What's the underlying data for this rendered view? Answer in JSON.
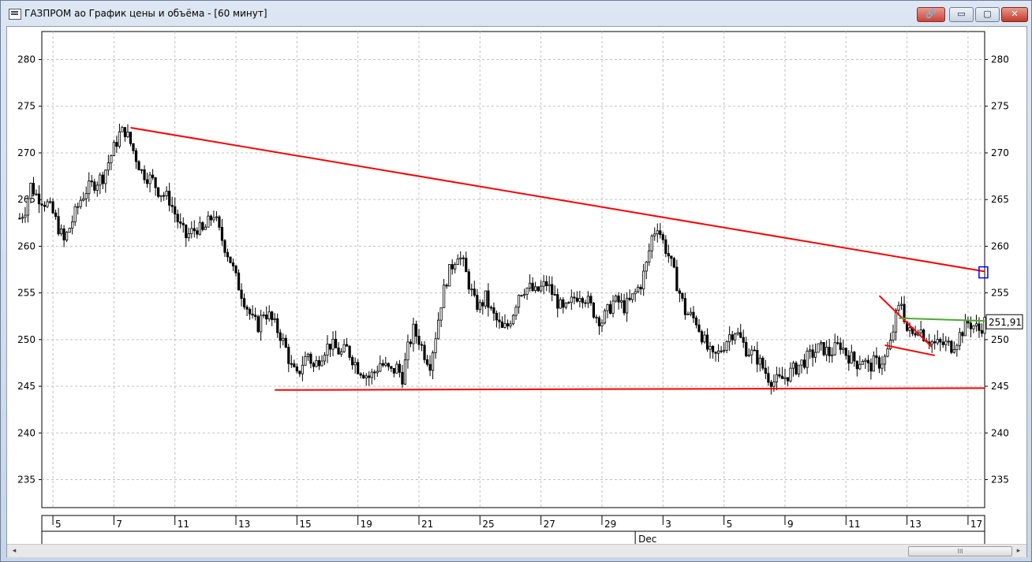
{
  "window": {
    "title": "ГАЗПРОМ ао График цены и объёма - [60 минут]",
    "buttons": {
      "link": "🔗",
      "minimize": "▭",
      "maximize": "▢",
      "close": "✕"
    }
  },
  "scrollbar": {
    "left_arrow": "◂",
    "right_arrow": "▸",
    "grip": "III"
  },
  "chart_data": {
    "type": "candlestick",
    "ylim": [
      232,
      283
    ],
    "yticks": [
      235,
      240,
      245,
      250,
      255,
      260,
      265,
      270,
      275,
      280
    ],
    "ytick_labels": [
      "235",
      "240",
      "245",
      "250",
      "255",
      "260",
      "265",
      "270",
      "275",
      "280"
    ],
    "grid": true,
    "xlim": [
      4,
      174
    ],
    "x_ticks": [
      {
        "x": 6,
        "label": "5"
      },
      {
        "x": 17,
        "label": "7"
      },
      {
        "x": 28,
        "label": "11"
      },
      {
        "x": 39,
        "label": "13"
      },
      {
        "x": 50,
        "label": "15"
      },
      {
        "x": 61,
        "label": "19"
      },
      {
        "x": 72,
        "label": "21"
      },
      {
        "x": 83,
        "label": "25"
      },
      {
        "x": 94,
        "label": "27"
      },
      {
        "x": 105,
        "label": "29"
      },
      {
        "x": 116,
        "label": "3"
      },
      {
        "x": 127,
        "label": "5"
      },
      {
        "x": 138,
        "label": "9"
      },
      {
        "x": 149,
        "label": "11"
      },
      {
        "x": 160,
        "label": "13"
      },
      {
        "x": 171,
        "label": "17"
      }
    ],
    "month_label": "Dec",
    "month_x": 111,
    "last_price": "251,91",
    "last_price_value": 251.91,
    "colors": {
      "candle": "#000000",
      "trendline": "#ff0000",
      "trendline_green": "#4ea832",
      "grid": "#c0c0c0",
      "marker": "#0000ff"
    },
    "trendlines": [
      {
        "color": "red",
        "x1": 20,
        "y1": 272.7,
        "x2": 174,
        "y2": 257.3
      },
      {
        "color": "red",
        "x1": 46,
        "y1": 244.6,
        "x2": 174,
        "y2": 244.8
      },
      {
        "color": "red",
        "x1": 155,
        "y1": 254.7,
        "x2": 164.5,
        "y2": 249.2
      },
      {
        "color": "red",
        "x1": 156,
        "y1": 249.4,
        "x2": 165,
        "y2": 248.3
      },
      {
        "color": "green",
        "x1": 158.5,
        "y1": 252.3,
        "x2": 174,
        "y2": 252.0
      }
    ],
    "marker": {
      "x": 173.7,
      "y": 257.2
    },
    "anchors": [
      [
        0,
        263.0
      ],
      [
        1,
        264.0
      ],
      [
        2,
        266.5
      ],
      [
        3,
        265.5
      ],
      [
        4,
        265.0
      ],
      [
        5,
        264.5
      ],
      [
        6,
        263.5
      ],
      [
        7,
        262.0
      ],
      [
        8,
        260.5
      ],
      [
        9,
        262.0
      ],
      [
        10,
        263.5
      ],
      [
        11,
        265.0
      ],
      [
        12,
        266.0
      ],
      [
        13,
        266.5
      ],
      [
        14,
        267.0
      ],
      [
        15,
        267.5
      ],
      [
        16,
        269.0
      ],
      [
        17,
        270.5
      ],
      [
        18,
        272.0
      ],
      [
        19,
        272.4
      ],
      [
        20,
        271.0
      ],
      [
        21,
        269.5
      ],
      [
        22,
        268.0
      ],
      [
        23,
        267.5
      ],
      [
        24,
        267.0
      ],
      [
        25,
        266.0
      ],
      [
        26,
        265.5
      ],
      [
        27,
        265.0
      ],
      [
        28,
        263.5
      ],
      [
        29,
        262.0
      ],
      [
        30,
        261.0
      ],
      [
        31,
        261.5
      ],
      [
        32,
        262.0
      ],
      [
        33,
        261.5
      ],
      [
        34,
        262.5
      ],
      [
        35,
        263.5
      ],
      [
        36,
        261.5
      ],
      [
        37,
        260.0
      ],
      [
        38,
        258.5
      ],
      [
        39,
        256.5
      ],
      [
        40,
        255.0
      ],
      [
        41,
        253.5
      ],
      [
        42,
        252.0
      ],
      [
        43,
        251.5
      ],
      [
        44,
        253.0
      ],
      [
        45,
        252.5
      ],
      [
        46,
        251.5
      ],
      [
        47,
        250.5
      ],
      [
        48,
        249.0
      ],
      [
        49,
        247.0
      ],
      [
        50,
        246.0
      ],
      [
        51,
        247.5
      ],
      [
        52,
        248.5
      ],
      [
        53,
        247.0
      ],
      [
        54,
        248.0
      ],
      [
        55,
        249.0
      ],
      [
        56,
        249.5
      ],
      [
        57,
        249.0
      ],
      [
        58,
        248.5
      ],
      [
        59,
        249.0
      ],
      [
        60,
        248.0
      ],
      [
        61,
        247.0
      ],
      [
        62,
        246.5
      ],
      [
        63,
        246.0
      ],
      [
        64,
        246.5
      ],
      [
        65,
        247.5
      ],
      [
        66,
        247.0
      ],
      [
        67,
        246.5
      ],
      [
        68,
        247.0
      ],
      [
        69,
        246.0
      ],
      [
        70,
        249.0
      ],
      [
        71,
        251.0
      ],
      [
        72,
        250.0
      ],
      [
        73,
        248.5
      ],
      [
        74,
        247.5
      ],
      [
        75,
        250.5
      ],
      [
        76,
        254.0
      ],
      [
        77,
        256.5
      ],
      [
        78,
        258.0
      ],
      [
        79,
        259.3
      ],
      [
        80,
        258.0
      ],
      [
        81,
        256.0
      ],
      [
        82,
        254.0
      ],
      [
        83,
        253.5
      ],
      [
        84,
        254.5
      ],
      [
        85,
        253.0
      ],
      [
        86,
        252.0
      ],
      [
        87,
        251.0
      ],
      [
        88,
        251.5
      ],
      [
        89,
        253.0
      ],
      [
        90,
        255.0
      ],
      [
        91,
        255.5
      ],
      [
        92,
        255.5
      ],
      [
        93,
        255.0
      ],
      [
        94,
        255.5
      ],
      [
        95,
        256.0
      ],
      [
        96,
        255.0
      ],
      [
        97,
        254.0
      ],
      [
        98,
        253.0
      ],
      [
        99,
        253.5
      ],
      [
        100,
        254.5
      ],
      [
        101,
        255.0
      ],
      [
        102,
        254.5
      ],
      [
        103,
        253.5
      ],
      [
        104,
        252.5
      ],
      [
        105,
        252.0
      ],
      [
        106,
        253.0
      ],
      [
        107,
        254.0
      ],
      [
        108,
        254.0
      ],
      [
        109,
        253.5
      ],
      [
        110,
        254.0
      ],
      [
        111,
        255.0
      ],
      [
        112,
        256.0
      ],
      [
        113,
        258.0
      ],
      [
        114,
        261.0
      ],
      [
        115,
        262.3
      ],
      [
        116,
        260.5
      ],
      [
        117,
        259.0
      ],
      [
        118,
        257.0
      ],
      [
        119,
        255.0
      ],
      [
        120,
        253.0
      ],
      [
        121,
        252.5
      ],
      [
        122,
        252.0
      ],
      [
        123,
        250.5
      ],
      [
        124,
        249.0
      ],
      [
        125,
        248.0
      ],
      [
        126,
        248.5
      ],
      [
        127,
        249.5
      ],
      [
        128,
        250.5
      ],
      [
        129,
        251.0
      ],
      [
        130,
        250.0
      ],
      [
        131,
        249.0
      ],
      [
        132,
        248.5
      ],
      [
        133,
        248.0
      ],
      [
        134,
        247.0
      ],
      [
        135,
        246.0
      ],
      [
        136,
        245.5
      ],
      [
        137,
        245.6
      ],
      [
        138,
        246.0
      ],
      [
        139,
        246.5
      ],
      [
        140,
        247.0
      ],
      [
        141,
        247.5
      ],
      [
        142,
        248.0
      ],
      [
        143,
        248.5
      ],
      [
        144,
        249.0
      ],
      [
        145,
        249.0
      ],
      [
        146,
        248.5
      ],
      [
        147,
        249.0
      ],
      [
        148,
        249.5
      ],
      [
        149,
        248.5
      ],
      [
        150,
        248.0
      ],
      [
        151,
        247.5
      ],
      [
        152,
        248.0
      ],
      [
        153,
        247.0
      ],
      [
        154,
        247.5
      ],
      [
        155,
        247.5
      ],
      [
        156,
        248.0
      ],
      [
        157,
        249.5
      ],
      [
        158,
        252.5
      ],
      [
        159,
        254.0
      ],
      [
        160,
        251.0
      ],
      [
        161,
        250.5
      ],
      [
        162,
        251.5
      ],
      [
        163,
        250.5
      ],
      [
        164,
        250.0
      ],
      [
        165,
        249.5
      ],
      [
        166,
        249.5
      ],
      [
        167,
        249.5
      ],
      [
        168,
        249.3
      ],
      [
        169,
        250.0
      ],
      [
        170,
        251.0
      ],
      [
        171,
        251.8
      ],
      [
        172,
        251.5
      ],
      [
        173,
        251.0
      ],
      [
        174,
        251.9
      ]
    ]
  }
}
